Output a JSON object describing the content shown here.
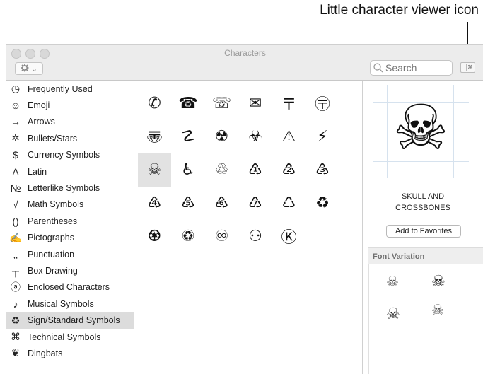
{
  "annotation": {
    "text": "Little character viewer icon"
  },
  "window": {
    "title": "Characters",
    "search_placeholder": "Search",
    "gear_chevron": "⌄",
    "viewer_icon_label": "⌘"
  },
  "categories": [
    {
      "label": "Frequently Used",
      "icon": "clock-icon",
      "glyph": "◷",
      "selected": false
    },
    {
      "label": "Emoji",
      "icon": "smiley-icon",
      "glyph": "☺",
      "selected": false
    },
    {
      "label": "Arrows",
      "icon": "arrow-icon",
      "glyph": "→",
      "selected": false
    },
    {
      "label": "Bullets/Stars",
      "icon": "asterisk-icon",
      "glyph": "✲",
      "selected": false
    },
    {
      "label": "Currency Symbols",
      "icon": "dollar-icon",
      "glyph": "$",
      "selected": false
    },
    {
      "label": "Latin",
      "icon": "latin-a-icon",
      "glyph": "A",
      "selected": false
    },
    {
      "label": "Letterlike Symbols",
      "icon": "numero-icon",
      "glyph": "№",
      "selected": false
    },
    {
      "label": "Math Symbols",
      "icon": "sqrt-icon",
      "glyph": "√",
      "selected": false
    },
    {
      "label": "Parentheses",
      "icon": "parentheses-icon",
      "glyph": "()",
      "selected": false
    },
    {
      "label": "Pictographs",
      "icon": "pencil-icon",
      "glyph": "✍",
      "selected": false
    },
    {
      "label": "Punctuation",
      "icon": "punctuation-icon",
      "glyph": "‚‚",
      "selected": false
    },
    {
      "label": "Box Drawing",
      "icon": "box-drawing-icon",
      "glyph": "┬",
      "selected": false
    },
    {
      "label": "Enclosed Characters",
      "icon": "circled-a-icon",
      "glyph": "ⓐ",
      "selected": false
    },
    {
      "label": "Musical Symbols",
      "icon": "music-note-icon",
      "glyph": "♪",
      "selected": false
    },
    {
      "label": "Sign/Standard Symbols",
      "icon": "recycle-icon",
      "glyph": "♻",
      "selected": true
    },
    {
      "label": "Technical Symbols",
      "icon": "command-key-icon",
      "glyph": "⌘",
      "selected": false
    },
    {
      "label": "Dingbats",
      "icon": "dingbat-icon",
      "glyph": "❦",
      "selected": false
    }
  ],
  "grid": [
    [
      "✆",
      "☎",
      "☏",
      "✉",
      "〒",
      "〶"
    ],
    [
      "〠",
      "☡",
      "☢",
      "☣",
      "⚠",
      "⚡"
    ],
    [
      "☠",
      "♿",
      "♲",
      "♳",
      "♴",
      "♵"
    ],
    [
      "♶",
      "♷",
      "♸",
      "♹",
      "♺",
      "♻"
    ],
    [
      "♼",
      "♽",
      "♾",
      "⚇",
      "Ⓚ",
      ""
    ]
  ],
  "selected_cell": [
    2,
    0
  ],
  "detail": {
    "preview_glyph": "☠",
    "name_line1": "SKULL AND",
    "name_line2": "CROSSBONES",
    "favorites_button": "Add to Favorites",
    "font_variation_title": "Font Variation",
    "variations": [
      "☠",
      "☠",
      "☠",
      "☠"
    ]
  }
}
